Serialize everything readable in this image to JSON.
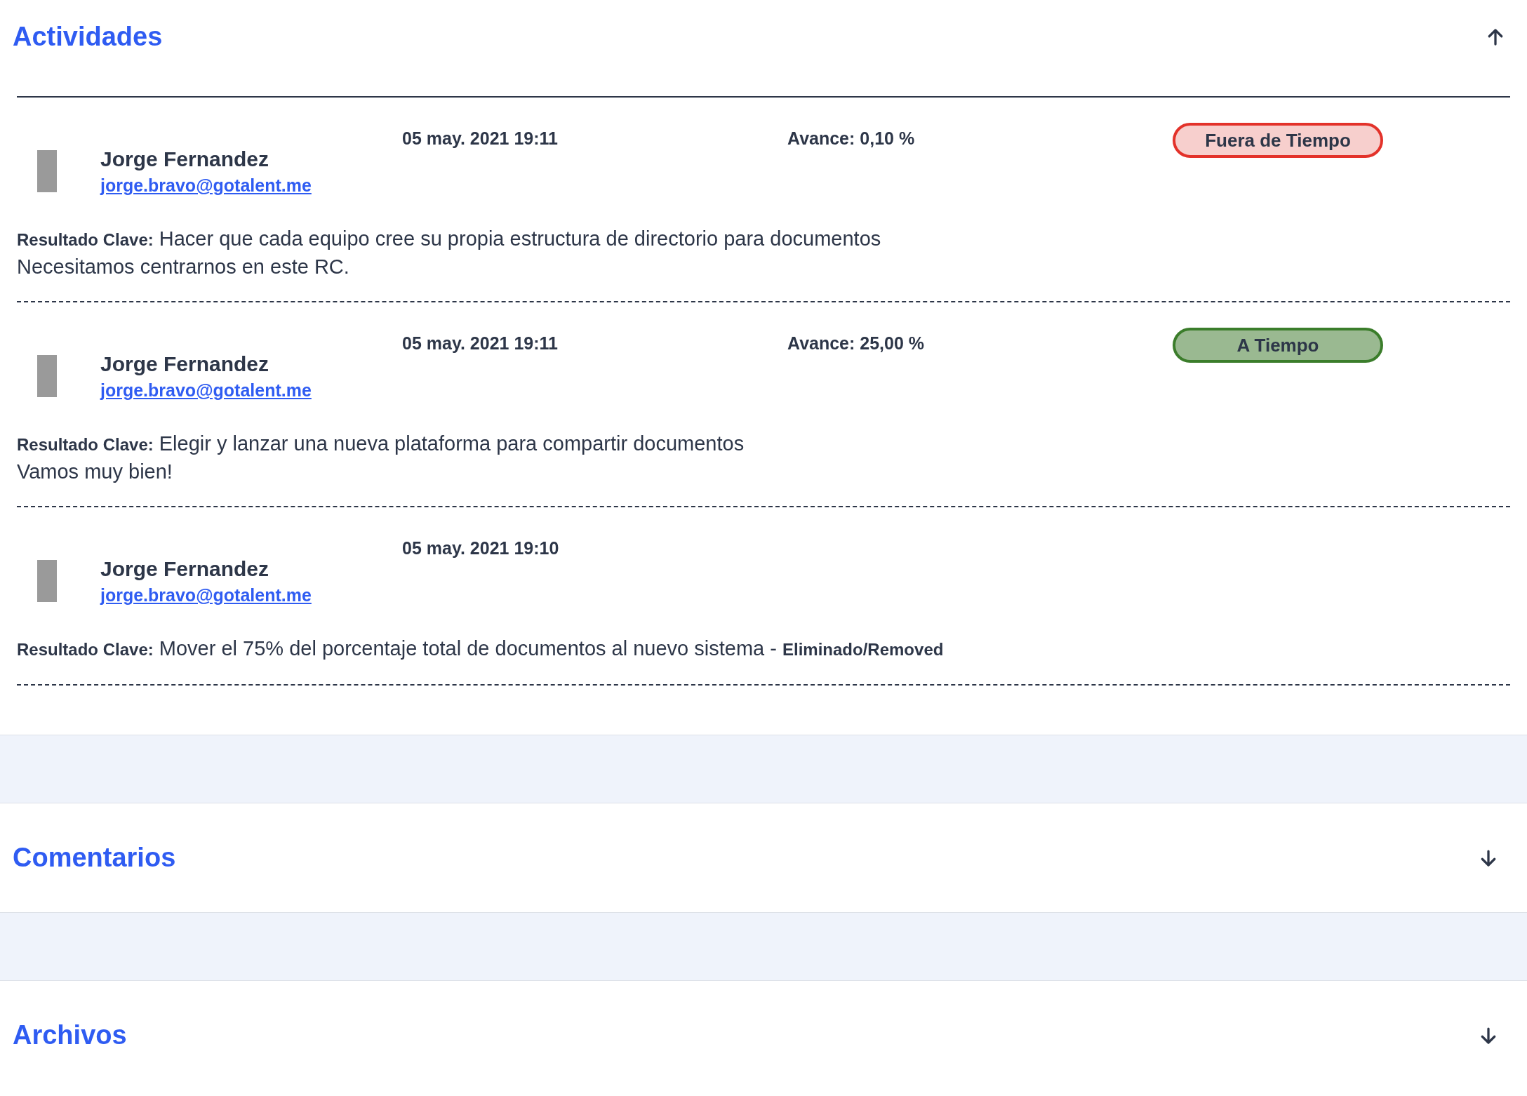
{
  "sections": [
    {
      "title": "Actividades",
      "expanded": true,
      "activities": [
        {
          "name": "Jorge Fernandez",
          "email": "jorge.bravo@gotalent.me",
          "date": "05 may. 2021 19:11",
          "progress": "Avance: 0,10 %",
          "status": {
            "kind": "late",
            "label": "Fuera de Tiempo"
          },
          "key_result": "**Resultado Clave:** Hacer que cada equipo cree su propia estructura de directorio para documentos",
          "note": "Necesitamos centrarnos en este RC."
        },
        {
          "name": "Jorge Fernandez",
          "email": "jorge.bravo@gotalent.me",
          "date": "05 may. 2021 19:11",
          "progress": "Avance: 25,00 %",
          "status": {
            "kind": "on_time",
            "label": "A Tiempo"
          },
          "key_result": "**Resultado Clave:** Elegir y lanzar una nueva plataforma para compartir documentos",
          "note": "Vamos muy bien!"
        },
        {
          "name": "Jorge Fernandez",
          "email": "jorge.bravo@gotalent.me",
          "date": "05 may. 2021 19:10",
          "key_result": "**Resultado Clave:** Mover el 75% del porcentaje total de documentos al nuevo sistema - **Eliminado/Removed**"
        }
      ]
    },
    {
      "title": "Comentarios",
      "expanded": false
    },
    {
      "title": "Archivos",
      "expanded": false
    }
  ]
}
